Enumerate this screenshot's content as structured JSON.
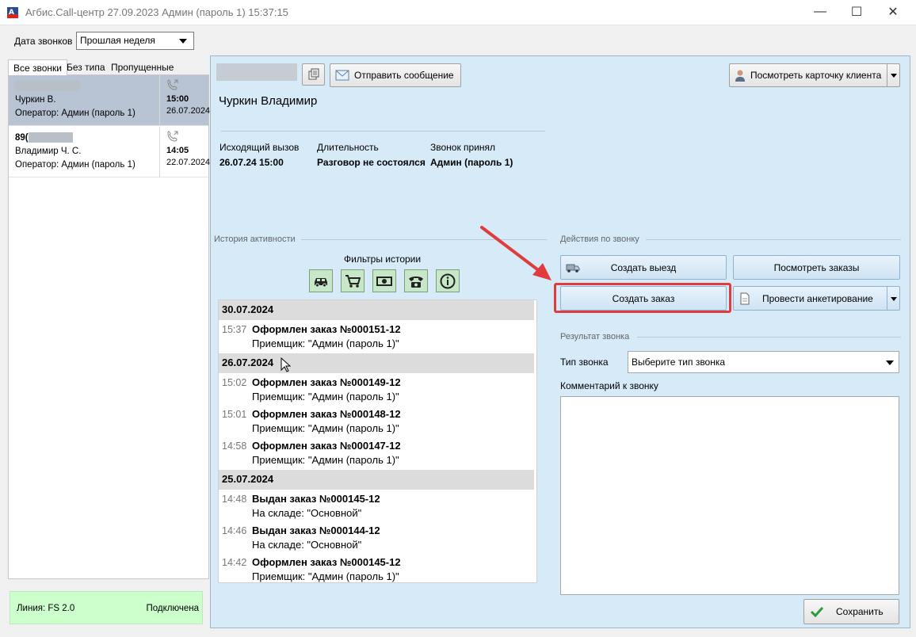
{
  "window": {
    "title": "Агбис.Call-центр 27.09.2023 Админ (пароль 1) 15:37:15",
    "minimize": "—",
    "maximize": "☐",
    "close": "✕"
  },
  "date_filter": {
    "label": "Дата звонков",
    "value": "Прошлая неделя"
  },
  "left_tabs": [
    "Все звонки",
    "Без типа",
    "Пропущенные"
  ],
  "calls": [
    {
      "phone": "",
      "name": "Чуркин В.",
      "operator": "Оператор: Админ (пароль 1)",
      "time": "15:00",
      "date": "26.07.2024",
      "selected": true
    },
    {
      "phone": "89(",
      "name": "Владимир  Ч. С.",
      "operator": "Оператор: Админ (пароль 1)",
      "time": "14:05",
      "date": "22.07.2024",
      "selected": false
    }
  ],
  "line_status": {
    "line": "Линия: FS 2.0",
    "state": "Подключена",
    "color": "#ccffcc"
  },
  "header": {
    "send_message": "Отправить сообщение",
    "client_name": "Чуркин Владимир",
    "view_client_card": "Посмотреть карточку клиента"
  },
  "call_details": {
    "type_label": "Исходящий вызов",
    "type_value": "26.07.24 15:00",
    "duration_label": "Длительность",
    "duration_value": "Разговор не состоялся",
    "accepted_label": "Звонок принял",
    "accepted_value": "Админ (пароль 1)"
  },
  "history": {
    "section_label": "История активности",
    "filters_label": "Фильтры истории",
    "filter_icons": [
      "car-icon",
      "cart-icon",
      "money-icon",
      "telephone-icon",
      "info-icon"
    ],
    "groups": [
      {
        "date": "30.07.2024",
        "items": [
          {
            "time": "15:37",
            "event": "Оформлен заказ №000151-12",
            "sub": "Приемщик: \"Админ (пароль 1)\""
          }
        ]
      },
      {
        "date": "26.07.2024",
        "items": [
          {
            "time": "15:02",
            "event": "Оформлен заказ №000149-12",
            "sub": "Приемщик: \"Админ (пароль 1)\""
          },
          {
            "time": "15:01",
            "event": "Оформлен заказ №000148-12",
            "sub": "Приемщик: \"Админ (пароль 1)\""
          },
          {
            "time": "14:58",
            "event": "Оформлен заказ №000147-12",
            "sub": "Приемщик: \"Админ (пароль 1)\""
          }
        ]
      },
      {
        "date": "25.07.2024",
        "items": [
          {
            "time": "14:48",
            "event": "Выдан заказ №000145-12",
            "sub": "На складе: \"Основной\""
          },
          {
            "time": "14:46",
            "event": "Выдан заказ №000144-12",
            "sub": "На складе: \"Основной\""
          },
          {
            "time": "14:42",
            "event": "Оформлен заказ №000145-12",
            "sub": "Приемщик: \"Админ (пароль 1)\""
          }
        ]
      }
    ]
  },
  "actions": {
    "section_label": "Действия по звонку",
    "create_visit": "Создать выезд",
    "view_orders": "Посмотреть заказы",
    "create_order": "Создать заказ",
    "survey": "Провести анкетирование"
  },
  "result": {
    "section_label": "Результат звонка",
    "type_label": "Тип звонка",
    "type_value": "Выберите тип звонка",
    "comment_label": "Комментарий к звонку",
    "comment_value": "",
    "save": "Сохранить"
  },
  "colors": {
    "main_bg": "#d6eaf8",
    "highlight": "#e03c3c",
    "filter_btn": "#c8e6c8",
    "selected_row": "#b8c4d4"
  }
}
